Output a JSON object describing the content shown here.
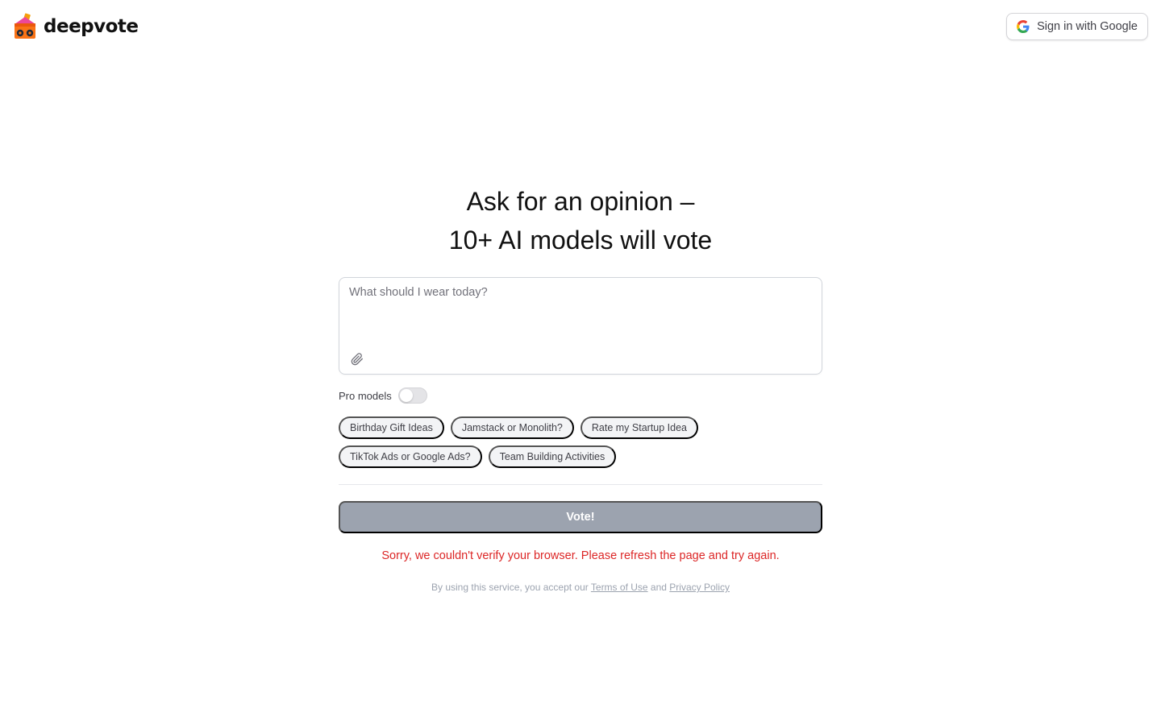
{
  "header": {
    "brand": "deepvote",
    "signin_label": "Sign in with Google"
  },
  "hero": {
    "line1": "Ask for an opinion –",
    "line2": "10+ AI models will vote"
  },
  "composer": {
    "placeholder": "What should I wear today?",
    "value": ""
  },
  "pro_models": {
    "label": "Pro models",
    "enabled": false
  },
  "suggestions": [
    "Birthday Gift Ideas",
    "Jamstack or Monolith?",
    "Rate my Startup Idea",
    "TikTok Ads or Google Ads?",
    "Team Building Activities"
  ],
  "vote_button": {
    "label": "Vote!",
    "color": "#9ca3af"
  },
  "error": {
    "message": "Sorry, we couldn't verify your browser. Please refresh the page and try again.",
    "color": "#dc2626"
  },
  "legal": {
    "prefix": "By using this service, you accept our",
    "terms": "Terms of Use",
    "conjunction": "and",
    "privacy": "Privacy Policy"
  }
}
